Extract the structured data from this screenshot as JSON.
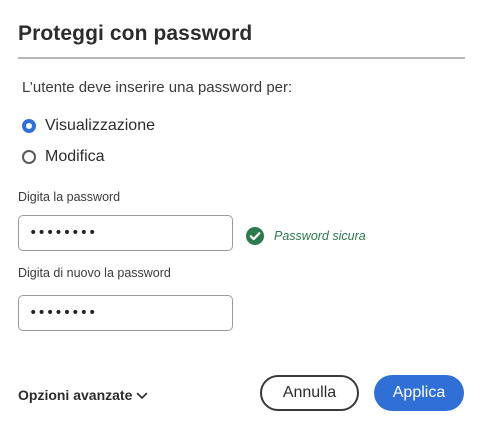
{
  "dialog": {
    "title": "Proteggi con password",
    "intro": "L’utente deve inserire una password per:",
    "options": [
      {
        "label": "Visualizzazione",
        "selected": true
      },
      {
        "label": "Modifica",
        "selected": false
      }
    ],
    "password_label": "Digita la password",
    "password_value": "••••••••",
    "confirm_label": "Digita di nuovo la password",
    "confirm_value": "••••••••",
    "strength_text": "Password sicura",
    "advanced_label": "Opzioni avanzate",
    "cancel_label": "Annulla",
    "apply_label": "Applica"
  },
  "colors": {
    "accent": "#2f6fd6",
    "success": "#2d7a4c",
    "text": "#2c2c2c",
    "divider": "#b8b8b8"
  },
  "icons": {
    "strength": "check-circle-icon",
    "advanced": "chevron-down-icon"
  }
}
